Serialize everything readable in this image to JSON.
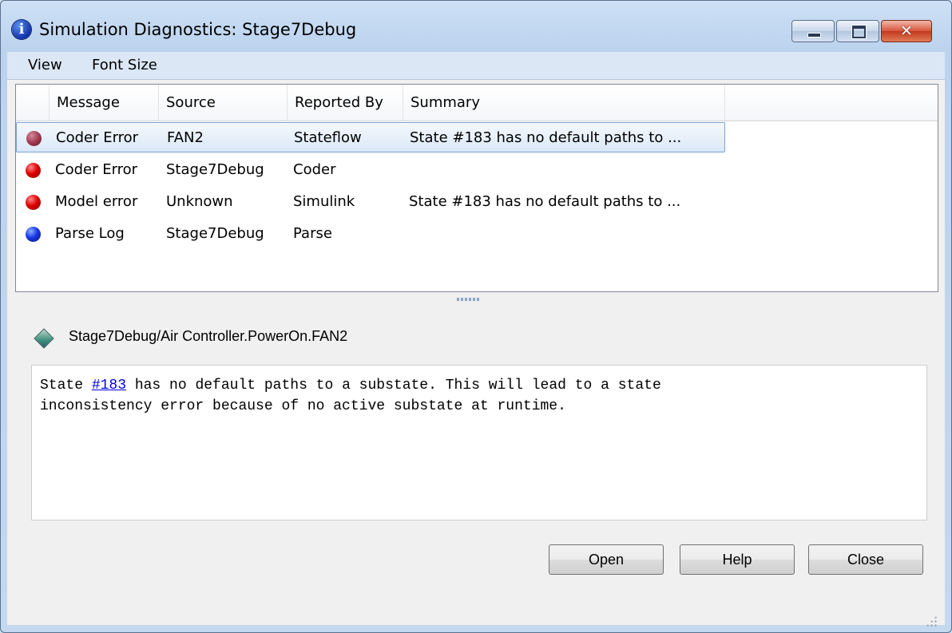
{
  "window": {
    "title": "Simulation Diagnostics: Stage7Debug",
    "icon": "info-icon",
    "controls": {
      "minimize": "minimize-icon",
      "maximize": "maximize-icon",
      "close_glyph": "✕"
    }
  },
  "menu": {
    "items": [
      "View",
      "Font Size"
    ]
  },
  "table": {
    "columns": [
      "Message",
      "Source",
      "Reported By",
      "Summary"
    ],
    "rows": [
      {
        "icon": "error-muted",
        "message": "Coder Error",
        "source": "FAN2",
        "reported_by": "Stateflow",
        "summary": "State #183 has no default paths to ...",
        "selected": true
      },
      {
        "icon": "error",
        "message": "Coder Error",
        "source": "Stage7Debug",
        "reported_by": "Coder",
        "summary": "",
        "selected": false
      },
      {
        "icon": "error",
        "message": "Model error",
        "source": "Unknown",
        "reported_by": "Simulink",
        "summary": "State #183 has no default paths to ...",
        "selected": false
      },
      {
        "icon": "info",
        "message": "Parse Log",
        "source": "Stage7Debug",
        "reported_by": "Parse",
        "summary": "",
        "selected": false
      }
    ]
  },
  "details": {
    "path": "Stage7Debug/Air Controller.PowerOn.FAN2",
    "text_before": "State ",
    "link": "#183",
    "text_after": " has no default paths to a substate. This will lead to a state\ninconsistency error because of no active substate at runtime."
  },
  "buttons": {
    "open": "Open",
    "help": "Help",
    "close": "Close"
  },
  "colors": {
    "error": "#e00000",
    "info": "#1836e6",
    "link": "#0000ee",
    "selection": "#dbe8f8"
  }
}
